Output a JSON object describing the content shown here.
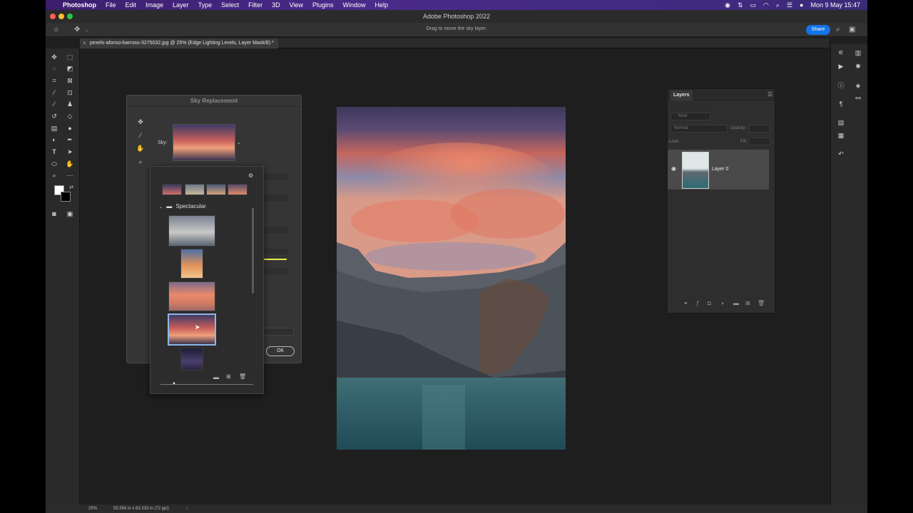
{
  "menubar": {
    "app": "Photoshop",
    "items": [
      "File",
      "Edit",
      "Image",
      "Layer",
      "Type",
      "Select",
      "Filter",
      "3D",
      "View",
      "Plugins",
      "Window",
      "Help"
    ],
    "datetime": "Mon 9 May  15:47"
  },
  "window_title": "Adobe Photoshop 2022",
  "options": {
    "hint": "Drag to move the sky layer.",
    "share_label": "Share"
  },
  "document_tab": "pexels-afonso-barroso-3275032.jpg @ 25% (Edge Lighting Levels, Layer Mask/8) *",
  "sky_dialog": {
    "title": "Sky Replacement",
    "sky_label": "Sky:",
    "ok_label": "OK"
  },
  "sky_presets": {
    "folder_name": "Spectacular"
  },
  "layers_panel": {
    "title": "Layers",
    "kind_placeholder": "Kind",
    "blend_mode": "Normal",
    "opacity_label": "Opacity:",
    "lock_label": "Lock:",
    "fill_label": "Fill:",
    "layer_name": "Layer 0"
  },
  "status": {
    "zoom": "25%",
    "doc_size": "55.556 in x 83.333 in (72 ppi)"
  },
  "colors": {
    "accent": "#1473e6",
    "selection": "#8fb8e6"
  }
}
